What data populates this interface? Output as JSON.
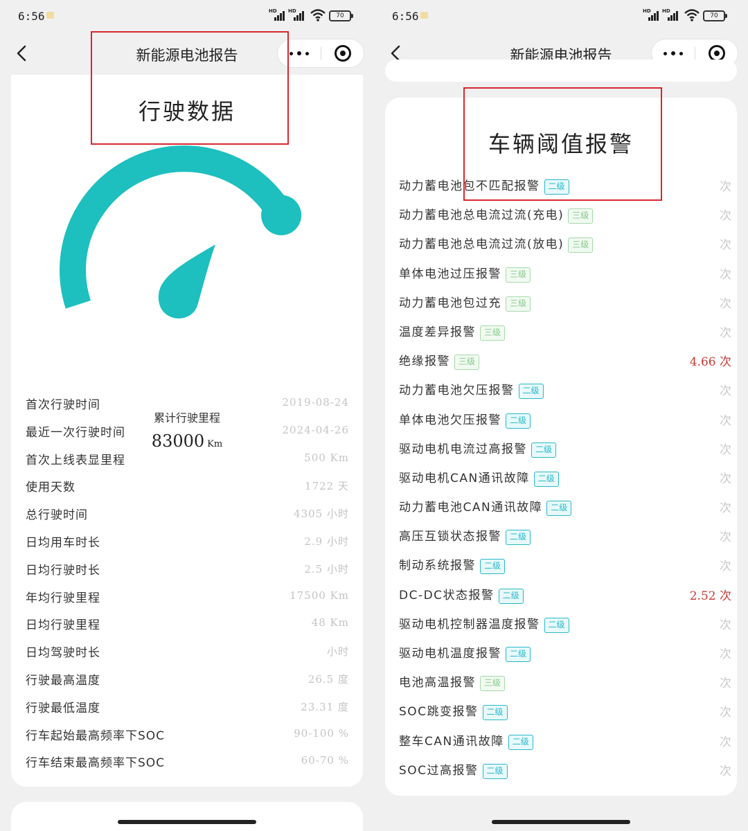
{
  "status_bar": {
    "time": "6:56",
    "battery": "70"
  },
  "left": {
    "nav_title": "新能源电池报告",
    "section_title": "行驶数据",
    "gauge": {
      "label": "累计行驶里程",
      "value": "83000",
      "unit": "Km",
      "fill_fraction": 0.78
    },
    "rows": [
      {
        "label": "首次行驶时间",
        "value": "2019-08-24"
      },
      {
        "label": "最近一次行驶时间",
        "value": "2024-04-26"
      },
      {
        "label": "首次上线表显里程",
        "value": "500 Km"
      },
      {
        "label": "使用天数",
        "value": "1722 天"
      },
      {
        "label": "总行驶时间",
        "value": "4305 小时"
      },
      {
        "label": "日均用车时长",
        "value": "2.9 小时"
      },
      {
        "label": "日均行驶时长",
        "value": "2.5 小时"
      },
      {
        "label": "年均行驶里程",
        "value": "17500 Km"
      },
      {
        "label": "日均行驶里程",
        "value": "48 Km"
      },
      {
        "label": "日均驾驶时长",
        "value": "小时"
      },
      {
        "label": "行驶最高温度",
        "value": "26.5 度"
      },
      {
        "label": "行驶最低温度",
        "value": "23.31 度"
      },
      {
        "label": "行车起始最高频率下SOC",
        "value": "90-100 %"
      },
      {
        "label": "行车结束最高频率下SOC",
        "value": "60-70 %"
      }
    ]
  },
  "right": {
    "nav_title": "新能源电池报告",
    "section_title": "车辆阈值报警",
    "alarms": [
      {
        "name": "动力蓄电池包不匹配报警",
        "level": "二级",
        "level_class": "l2",
        "count": "次",
        "alert": false
      },
      {
        "name": "动力蓄电池总电流过流(充电)",
        "level": "三级",
        "level_class": "l3",
        "count": "次",
        "alert": false
      },
      {
        "name": "动力蓄电池总电流过流(放电)",
        "level": "三级",
        "level_class": "l3",
        "count": "次",
        "alert": false
      },
      {
        "name": "单体电池过压报警",
        "level": "三级",
        "level_class": "l3",
        "count": "次",
        "alert": false
      },
      {
        "name": "动力蓄电池包过充",
        "level": "三级",
        "level_class": "l3",
        "count": "次",
        "alert": false
      },
      {
        "name": "温度差异报警",
        "level": "三级",
        "level_class": "l3",
        "count": "次",
        "alert": false
      },
      {
        "name": "绝缘报警",
        "level": "三级",
        "level_class": "l3",
        "count": "4.66 次",
        "alert": true
      },
      {
        "name": "动力蓄电池欠压报警",
        "level": "二级",
        "level_class": "l2",
        "count": "次",
        "alert": false
      },
      {
        "name": "单体电池欠压报警",
        "level": "二级",
        "level_class": "l2",
        "count": "次",
        "alert": false
      },
      {
        "name": "驱动电机电流过高报警",
        "level": "二级",
        "level_class": "l2",
        "count": "次",
        "alert": false
      },
      {
        "name": "驱动电机CAN通讯故障",
        "level": "二级",
        "level_class": "l2",
        "count": "次",
        "alert": false
      },
      {
        "name": "动力蓄电池CAN通讯故障",
        "level": "二级",
        "level_class": "l2",
        "count": "次",
        "alert": false
      },
      {
        "name": "高压互锁状态报警",
        "level": "二级",
        "level_class": "l2",
        "count": "次",
        "alert": false
      },
      {
        "name": "制动系统报警",
        "level": "二级",
        "level_class": "l2",
        "count": "次",
        "alert": false
      },
      {
        "name": "DC-DC状态报警",
        "level": "二级",
        "level_class": "l2",
        "count": "2.52 次",
        "alert": true
      },
      {
        "name": "驱动电机控制器温度报警",
        "level": "二级",
        "level_class": "l2",
        "count": "次",
        "alert": false
      },
      {
        "name": "驱动电机温度报警",
        "level": "二级",
        "level_class": "l2",
        "count": "次",
        "alert": false
      },
      {
        "name": "电池高温报警",
        "level": "三级",
        "level_class": "l3",
        "count": "次",
        "alert": false
      },
      {
        "name": "SOC跳变报警",
        "level": "二级",
        "level_class": "l2",
        "count": "次",
        "alert": false
      },
      {
        "name": "整车CAN通讯故障",
        "level": "二级",
        "level_class": "l2",
        "count": "次",
        "alert": false
      },
      {
        "name": "SOC过高报警",
        "level": "二级",
        "level_class": "l2",
        "count": "次",
        "alert": false
      }
    ]
  },
  "colors": {
    "gauge": "#1dbfbf",
    "highlight_border": "#d9262c",
    "level2": "#29b8c9",
    "level3": "#86c98c",
    "alert": "#c53a34"
  },
  "icons": [
    "back-arrow-icon",
    "more-dots-icon",
    "close-target-icon",
    "wifi-icon",
    "signal-icon",
    "battery-icon"
  ]
}
